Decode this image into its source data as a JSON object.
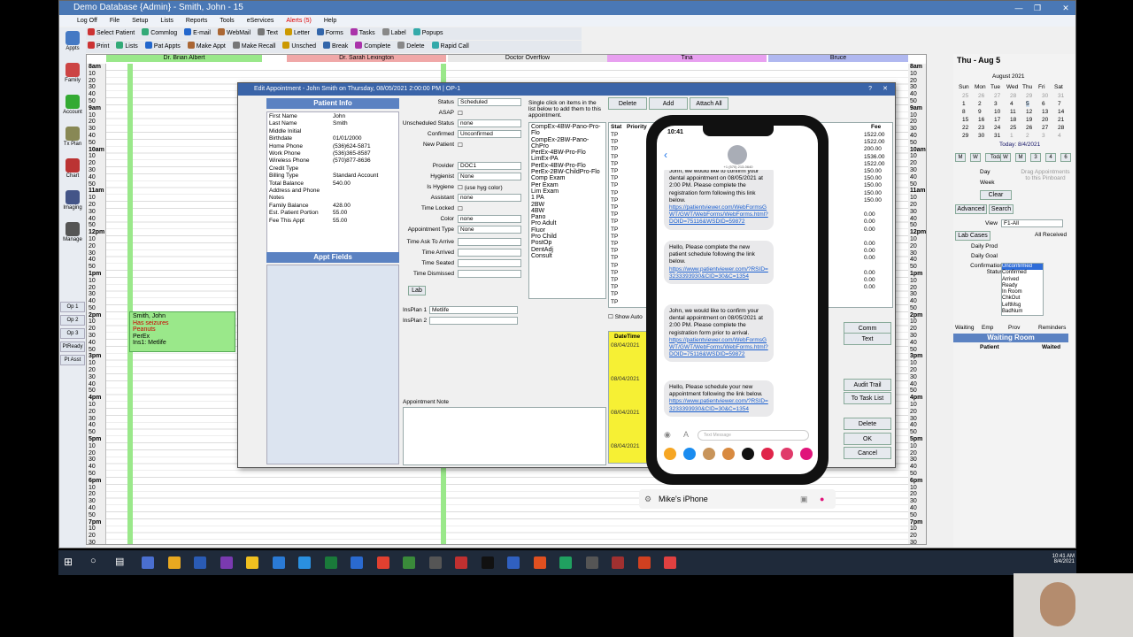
{
  "window_title": "Demo Database {Admin} - Smith, John - 15",
  "menu": [
    "Log Off",
    "File",
    "Setup",
    "Lists",
    "Reports",
    "Tools",
    "eServices",
    "Alerts (5)",
    "Help"
  ],
  "toolbar1": [
    "Select Patient",
    "Commlog",
    "E-mail",
    "WebMail",
    "Text",
    "Letter",
    "Forms",
    "Tasks",
    "Label",
    "Popups"
  ],
  "toolbar2": [
    "Print",
    "Lists",
    "Pat Appts",
    "Make Appt",
    "Make Recall",
    "Unsched",
    "Break",
    "Complete",
    "Delete",
    "Rapid Call"
  ],
  "nav": [
    "Appts",
    "Family",
    "Account",
    "Tx Plan",
    "Chart",
    "Imaging",
    "Manage"
  ],
  "ops": [
    "Op 1",
    "Op 2",
    "Op 3",
    "PtReady",
    "Pt Asst"
  ],
  "providers": [
    "Dr. Brian Albert",
    "Dr. Sarah Lexington",
    "Doctor Overflow",
    "Tina",
    "Bruce"
  ],
  "times": [
    "8am",
    "10",
    "20",
    "30",
    "40",
    "50",
    "9am",
    "10",
    "20",
    "30",
    "40",
    "50",
    "10am",
    "10",
    "20",
    "30",
    "40",
    "50",
    "11am",
    "10",
    "20",
    "30",
    "40",
    "50",
    "12pm",
    "10",
    "20",
    "30",
    "40",
    "50",
    "1pm",
    "10",
    "20",
    "30",
    "40",
    "50",
    "2pm",
    "10",
    "20",
    "30",
    "40",
    "50",
    "3pm",
    "10",
    "20",
    "30",
    "40",
    "50",
    "4pm",
    "10",
    "20",
    "30",
    "40",
    "50",
    "5pm",
    "10",
    "20",
    "30",
    "40",
    "50",
    "6pm",
    "10",
    "20",
    "30",
    "40",
    "50",
    "7pm",
    "10",
    "20",
    "30"
  ],
  "appointment": [
    "Smith, John",
    "Has seizures",
    "Peanuts",
    "PerEx",
    "Ins1: Metlife"
  ],
  "dialog": {
    "title": "Edit Appointment - John Smith on Thursday, 08/05/2021 2:00:00 PM | OP-1",
    "patient_info_header": "Patient Info",
    "appt_fields_header": "Appt Fields",
    "patient_info": [
      [
        "First Name",
        "John"
      ],
      [
        "Last Name",
        "Smith"
      ],
      [
        "Middle Initial",
        ""
      ],
      [
        "Birthdate",
        "01/01/2000"
      ],
      [
        "Home Phone",
        "(536)624-5871"
      ],
      [
        "Work Phone",
        "(536)365-8587"
      ],
      [
        "Wireless Phone",
        "(570)877-8636"
      ],
      [
        "Credit Type",
        ""
      ],
      [
        "Billing Type",
        "Standard Account"
      ],
      [
        "Total Balance",
        "540.00"
      ],
      [
        "Address and Phone",
        ""
      ],
      [
        "Notes",
        ""
      ],
      [
        "Family Balance",
        "428.00"
      ],
      [
        "Est. Patient Portion",
        "55.00"
      ],
      [
        "Fee This Appt",
        "55.00"
      ]
    ],
    "status_fields": [
      [
        "Status",
        "Scheduled"
      ],
      [
        "ASAP",
        ""
      ],
      [
        "Unscheduled Status",
        "none"
      ],
      [
        "Confirmed",
        "Unconfirmed"
      ],
      [
        "New Patient",
        ""
      ],
      [
        "Provider",
        "DOC1"
      ],
      [
        "Hygienist",
        "None"
      ],
      [
        "Is Hygiene",
        "(use hyg color)"
      ],
      [
        "Assistant",
        "none"
      ],
      [
        "Time Locked",
        ""
      ],
      [
        "Color",
        "none"
      ],
      [
        "Appointment Type",
        "None"
      ],
      [
        "Time Ask To Arrive",
        ""
      ],
      [
        "Time Arrived",
        ""
      ],
      [
        "Time Seated",
        ""
      ],
      [
        "Time Dismissed",
        ""
      ]
    ],
    "lab_label": "Lab",
    "ins_plan1": "Metlife",
    "ins_plan_labels": [
      "InsPlan 1",
      "InsPlan 2"
    ],
    "appointment_note_label": "Appointment Note",
    "instructions": "Single click on items in the list below to add them to this appointment.",
    "procedure_list": [
      "CompEx-4BW-Pano-Pro-Flo",
      "CompEx-2BW-Pano-ChPro",
      "PerEx-4BW-Pro-Flo",
      "LimEx-PA",
      "PerEx-4BW-Pro-Flo",
      "PerEx-2BW-ChildPro-Flo",
      "Comp Exam",
      "Per Exam",
      "Lim Exam",
      "1 PA",
      "2BW",
      "4BW",
      "Pano",
      "Pro Adult",
      "Fluor",
      "Pro Child",
      "PostOp",
      "DentAdj",
      "Consult"
    ],
    "top_buttons": [
      "Delete",
      "Add",
      "Attach All"
    ],
    "grid_headers": [
      "Stat",
      "Priority",
      "Fee"
    ],
    "grid_stat": [
      "TP",
      "TP",
      "TP",
      "TP",
      "TP",
      "TP",
      "TP",
      "TP",
      "TP",
      "TP",
      "TP",
      "TP",
      "TP",
      "TP",
      "TP",
      "TP",
      "TP",
      "TP",
      "TP",
      "TP",
      "TP",
      "TP",
      "TP",
      "TP"
    ],
    "grid_fee": [
      "1522.00",
      "1522.00",
      "200.00",
      "1536.00",
      "1522.00",
      "150.00",
      "150.00",
      "150.00",
      "150.00",
      "150.00",
      "",
      "0.00",
      "0.00",
      "0.00",
      "",
      "0.00",
      "0.00",
      "0.00",
      "",
      "0.00",
      "0.00",
      "0.00"
    ],
    "show_label": "Show Auto",
    "history_header": "DateTime",
    "history_dates": [
      "08/04/2021",
      "08/04/2021",
      "08/04/2021",
      "08/04/2021"
    ],
    "side_buttons": [
      "Comm",
      "Text",
      "Audit Trail",
      "To Task List",
      "Delete",
      "OK",
      "Cancel"
    ]
  },
  "phone": {
    "time": "10:41",
    "contact_number": "+1 (570) 213-0640",
    "messages": [
      {
        "text": "John, we would like to confirm your dental appointment on 08/05/2021 at 2:00 PM. Please complete the registration form following this link below.",
        "link": "https://patientviewer.com/WebFormsGWT/GWT/WebForms/WebForms.html?DOID=75116&WSDID=59872"
      },
      {
        "text": "Hello, Please complete the new patient schedule following the link below.",
        "link": "https://www.patientviewer.com/?RSID=3233393930&CID=30&C=1354"
      },
      {
        "text": "John, we would like to confirm your dental appointment on 08/05/2021 at 2:00 PM. Please complete the registration form prior to arrival.",
        "link": "https://patientviewer.com/WebFormsGWT/GWT/WebForms/WebForms.html?DOID=75116&WSDID=59872"
      },
      {
        "text": "Hello, Please schedule your new appointment following the link below.",
        "link": "https://www.patientviewer.com/?RSID=3233393930&CID=30&C=1354"
      }
    ],
    "input_placeholder": "Text Message",
    "label": "Mike's iPhone"
  },
  "right_panel": {
    "date": "Thu  -  Aug 5",
    "month": "August 2021",
    "weekdays": [
      "Sun",
      "Mon",
      "Tue",
      "Wed",
      "Thu",
      "Fri",
      "Sat"
    ],
    "calendar": [
      [
        "25",
        "26",
        "27",
        "28",
        "29",
        "30",
        "31"
      ],
      [
        "1",
        "2",
        "3",
        "4",
        "5",
        "6",
        "7"
      ],
      [
        "8",
        "9",
        "10",
        "11",
        "12",
        "13",
        "14"
      ],
      [
        "15",
        "16",
        "17",
        "18",
        "19",
        "20",
        "21"
      ],
      [
        "22",
        "23",
        "24",
        "25",
        "26",
        "27",
        "28"
      ],
      [
        "29",
        "30",
        "31",
        "1",
        "2",
        "3",
        "4"
      ]
    ],
    "today_label": "Today: 8/4/2021",
    "view_buttons": [
      "M",
      "W",
      "Today",
      "W",
      "M",
      "3",
      "4",
      "6"
    ],
    "day_label": "Day",
    "week_label": "Week",
    "clear_label": "Clear",
    "pinboard_text": "Drag Appointments to this Pinboard",
    "advanced_label": "Advanced",
    "search_label": "Search",
    "view_label": "View",
    "view_value": "F1-All",
    "lab_cases": "Lab Cases",
    "all_received": "All Received",
    "daily_prod": "Daily Prod",
    "daily_goal": "Daily Goal",
    "confirmation_label": "Confirmation Status",
    "confirmation_options": [
      "Unconfirmed",
      "Confirmed",
      "Arrived",
      "Ready",
      "In Room",
      "ChkOut",
      "LeftMsg",
      "BadNum"
    ],
    "tabs": [
      "Waiting",
      "Emp",
      "Prov",
      "Reminders"
    ],
    "waiting_room": "Waiting Room",
    "waiting_cols": [
      "Patient",
      "Waited"
    ]
  },
  "taskbar": {
    "time": "10:41 AM",
    "date": "8/4/2021"
  }
}
